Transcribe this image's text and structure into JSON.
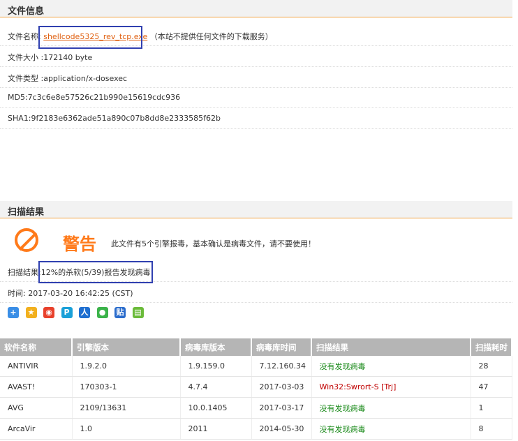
{
  "file_info": {
    "section_title": "文件信息",
    "name_label": "文件名称:",
    "name_value": "shellcode5325_rev_tcp.exe",
    "name_note": "（本站不提供任何文件的下载服务）",
    "size": "文件大小 :172140 byte",
    "type": "文件类型 :application/x-dosexec",
    "md5": "MD5:7c3c6e8e57526c21b990e15619cdc936",
    "sha1": "SHA1:9f2183e6362ade51a890c07b8dd8e2333585f62b"
  },
  "scan": {
    "section_title": "扫描结果",
    "warn_title": "警告",
    "warn_text": "此文件有5个引擎报毒，基本确认是病毒文件，请不要使用！",
    "result": "扫描结果:12%的杀软(5/39)报告发现病毒",
    "time": "时间: 2017-03-20 16:42:25 (CST)",
    "colors": {
      "warning": "#ff7a1a",
      "ok": "#1a8a1a",
      "bad": "#c00000"
    }
  },
  "share_icons": [
    "plus-share-icon",
    "star-share-icon",
    "weibo-share-icon",
    "p-share-icon",
    "renren-share-icon",
    "wechat-share-icon",
    "tieba-share-icon",
    "bookmark-share-icon"
  ],
  "table": {
    "headers": [
      "软件名称",
      "引擎版本",
      "病毒库版本",
      "病毒库时间",
      "扫描结果",
      "扫描耗时"
    ],
    "rows": [
      {
        "name": "ANTIVIR",
        "engine": "1.9.2.0",
        "db": "1.9.159.0",
        "db_time": "7.12.160.34",
        "result": "没有发现病毒",
        "status": "ok",
        "time": "28"
      },
      {
        "name": "AVAST!",
        "engine": "170303-1",
        "db": "4.7.4",
        "db_time": "2017-03-03",
        "result": "Win32:Swrort-S [Trj]",
        "status": "bad",
        "time": "47"
      },
      {
        "name": "AVG",
        "engine": "2109/13631",
        "db": "10.0.1405",
        "db_time": "2017-03-17",
        "result": "没有发现病毒",
        "status": "ok",
        "time": "1"
      },
      {
        "name": "ArcaVir",
        "engine": "1.0",
        "db": "2011",
        "db_time": "2014-05-30",
        "result": "没有发现病毒",
        "status": "ok",
        "time": "8"
      }
    ]
  }
}
